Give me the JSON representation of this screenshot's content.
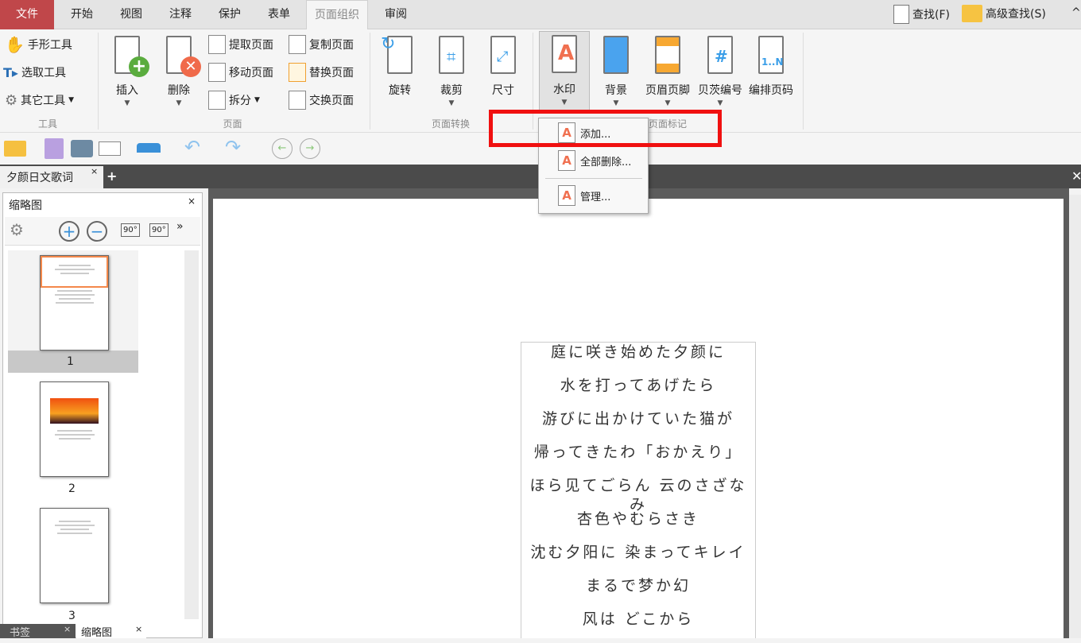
{
  "menu_tabs": [
    "文件",
    "开始",
    "视图",
    "注释",
    "保护",
    "表单",
    "页面组织",
    "审阅"
  ],
  "active_tab": "页面组织",
  "search": {
    "find": "查找(F)",
    "advanced_find": "高级查找(S)"
  },
  "ribbon": {
    "tools": {
      "label": "工具",
      "items": [
        "手形工具",
        "选取工具",
        "其它工具"
      ]
    },
    "pages": {
      "label": "页面",
      "insert": "插入",
      "delete": "删除",
      "extract": "提取页面",
      "move": "移动页面",
      "split": "拆分",
      "copy": "复制页面",
      "replace": "替换页面",
      "swap": "交换页面"
    },
    "transform": {
      "label": "页面转换",
      "rotate": "旋转",
      "crop": "裁剪",
      "size": "尺寸"
    },
    "marks": {
      "label": "页面标记",
      "watermark": "水印",
      "background": "背景",
      "header_footer": "页眉页脚",
      "bates": "贝茨编号",
      "page_number": "编排页码"
    }
  },
  "watermark_menu": {
    "add": "添加...",
    "remove_all": "全部删除...",
    "manage": "管理..."
  },
  "doc_tab": "夕颜日文歌词",
  "thumbnail_panel": {
    "title": "缩略图",
    "rotate_left": "90°",
    "rotate_right": "90°",
    "pages": [
      "1",
      "2",
      "3"
    ]
  },
  "bottom_tabs": [
    "书签",
    "缩略图"
  ],
  "lyrics": [
    "庭に咲き始めた夕颜に",
    "水を打ってあげたら",
    "游びに出かけていた猫が",
    "帰ってきたわ「おかえり」",
    "ほら见てごらん 云のさざなみ",
    "杏色やむらさき",
    "沈む夕阳に 染まってキレイ",
    "まるで梦か幻",
    "风は どこから"
  ],
  "colors": {
    "file_tab": "#c0474a",
    "highlight": "#f01010"
  }
}
